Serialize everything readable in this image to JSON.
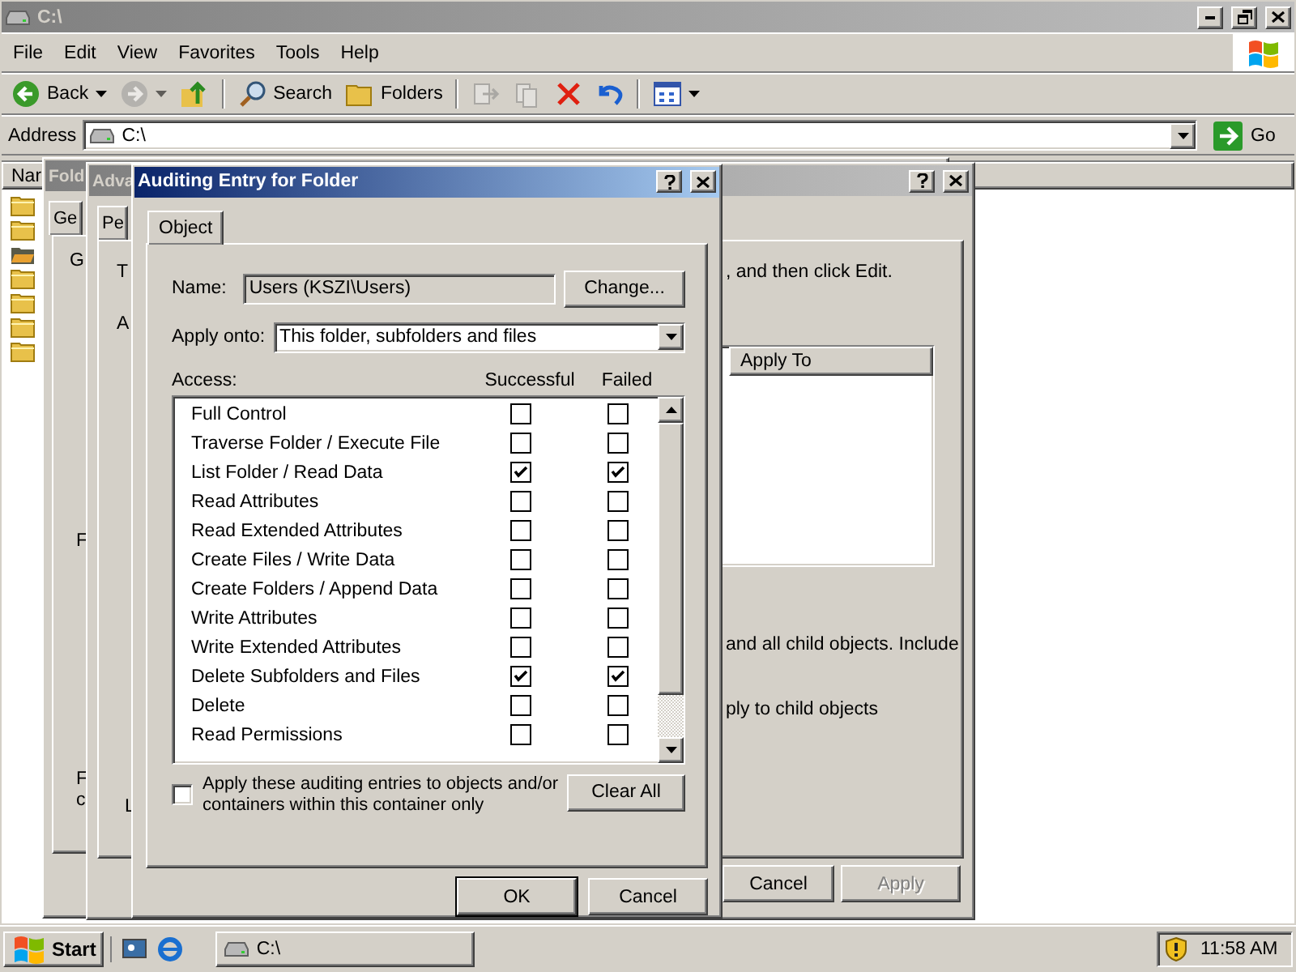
{
  "explorer": {
    "title": "C:\\",
    "menu": [
      "File",
      "Edit",
      "View",
      "Favorites",
      "Tools",
      "Help"
    ],
    "toolbar": [
      {
        "kind": "back",
        "label": "Back",
        "disabled": false
      },
      {
        "kind": "forward",
        "disabled": true
      },
      {
        "kind": "up",
        "disabled": false
      },
      {
        "kind": "search",
        "label": "Search",
        "disabled": false
      },
      {
        "kind": "folders",
        "label": "Folders",
        "disabled": false
      },
      {
        "kind": "move",
        "disabled": true
      },
      {
        "kind": "copy",
        "disabled": true
      },
      {
        "kind": "delete",
        "disabled": false
      },
      {
        "kind": "undo",
        "disabled": false
      },
      {
        "kind": "views",
        "disabled": false
      }
    ],
    "address": {
      "label": "Address",
      "value": "C:\\",
      "go": "Go"
    },
    "column": "Nar",
    "items": [
      {
        "kind": "folder"
      },
      {
        "kind": "folder"
      },
      {
        "kind": "special"
      },
      {
        "kind": "folder"
      },
      {
        "kind": "folder"
      },
      {
        "kind": "folder"
      },
      {
        "kind": "folder"
      }
    ]
  },
  "folder_dialog": {
    "title": "Fold",
    "tab": "Ge",
    "group_label": "G",
    "second_label": "F",
    "note_lines": [
      "F",
      "c"
    ]
  },
  "advanced_dialog": {
    "title": "Adva",
    "tab": "Pe",
    "intro": "T",
    "list_label": "A",
    "instruction": ", and then click Edit.",
    "column": "Apply To",
    "inherit_text": "and all child objects. Include",
    "replace_text": "ply to child objects",
    "bottom_label": "L",
    "buttons": [
      {
        "label": "Cancel",
        "disabled": false
      },
      {
        "label": "Apply",
        "disabled": true
      }
    ]
  },
  "auditing_dialog": {
    "title": "Auditing Entry for Folder",
    "tab": "Object",
    "name_label": "Name:",
    "name_value": "Users (KSZI\\Users)",
    "change": "Change...",
    "apply_label": "Apply onto:",
    "apply_value": "This folder, subfolders and files",
    "access_label": "Access:",
    "columns": [
      "Successful",
      "Failed"
    ],
    "entries": [
      {
        "name": "Full Control",
        "successful": false,
        "failed": false
      },
      {
        "name": "Traverse Folder / Execute File",
        "successful": false,
        "failed": false
      },
      {
        "name": "List Folder / Read Data",
        "successful": true,
        "failed": true
      },
      {
        "name": "Read Attributes",
        "successful": false,
        "failed": false
      },
      {
        "name": "Read Extended Attributes",
        "successful": false,
        "failed": false
      },
      {
        "name": "Create Files / Write Data",
        "successful": false,
        "failed": false
      },
      {
        "name": "Create Folders / Append Data",
        "successful": false,
        "failed": false
      },
      {
        "name": "Write Attributes",
        "successful": false,
        "failed": false
      },
      {
        "name": "Write Extended Attributes",
        "successful": false,
        "failed": false
      },
      {
        "name": "Delete Subfolders and Files",
        "successful": true,
        "failed": true
      },
      {
        "name": "Delete",
        "successful": false,
        "failed": false
      },
      {
        "name": "Read Permissions",
        "successful": false,
        "failed": false
      }
    ],
    "apply_only": {
      "label": "Apply these auditing entries to objects and/or containers within this container only",
      "checked": false
    },
    "clear": "Clear All",
    "buttons": [
      "OK",
      "Cancel"
    ]
  },
  "taskbar": {
    "start": "Start",
    "quick_launch": [
      {
        "kind": "desktop"
      },
      {
        "kind": "browser"
      }
    ],
    "tasks": [
      {
        "label": "C:\\",
        "selected": false
      }
    ],
    "clock": "11:58 AM"
  }
}
